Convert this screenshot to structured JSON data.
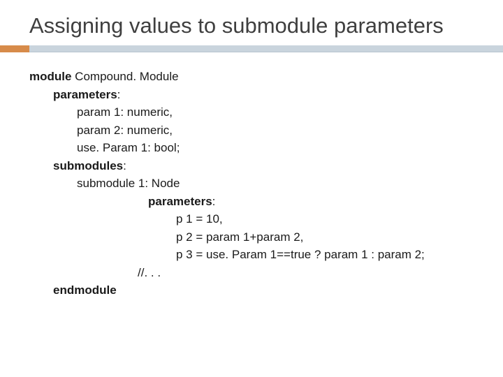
{
  "title": "Assigning values to submodule parameters",
  "code": {
    "l1_kw": "module",
    "l1_rest": " Compound. Module",
    "l2_kw": "parameters",
    "l2_rest": ":",
    "l3": "param 1: numeric,",
    "l4": "param 2: numeric,",
    "l5": "use. Param 1: bool;",
    "l6_kw": "submodules",
    "l6_rest": ":",
    "l7": "submodule 1: Node",
    "l8_kw": "parameters",
    "l8_rest": ":",
    "l9": "p 1 = 10,",
    "l10": "p 2 = param 1+param 2,",
    "l11": "p 3 = use. Param 1==true ? param 1 : param 2;",
    "l12": "//. . .",
    "l13_kw": "endmodule"
  }
}
